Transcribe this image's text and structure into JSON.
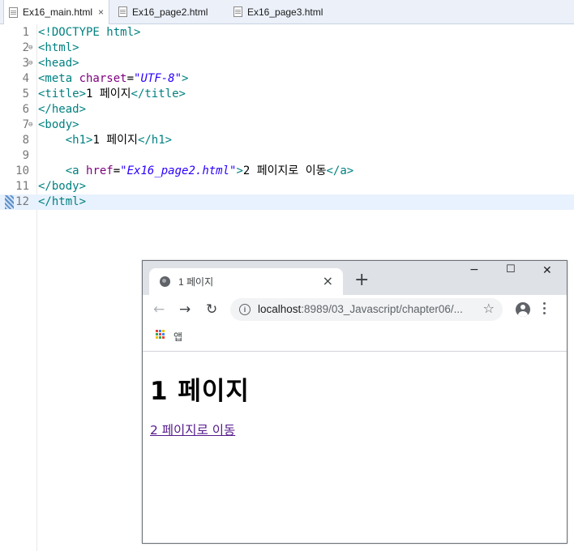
{
  "editor": {
    "tabs": [
      {
        "label": "Ex16_main.html",
        "active": true,
        "close": "×"
      },
      {
        "label": "Ex16_page2.html",
        "active": false
      },
      {
        "label": "Ex16_page3.html",
        "active": false
      }
    ],
    "lines": [
      {
        "n": "1",
        "parts": [
          [
            "tag",
            "<!DOCTYPE html>"
          ]
        ]
      },
      {
        "n": "2",
        "fold": "⊖",
        "parts": [
          [
            "tag",
            "<html>"
          ]
        ]
      },
      {
        "n": "3",
        "fold": "⊖",
        "parts": [
          [
            "tag",
            "<head>"
          ]
        ]
      },
      {
        "n": "4",
        "parts": [
          [
            "tag",
            "<meta "
          ],
          [
            "attr",
            "charset"
          ],
          [
            "txt",
            "="
          ],
          [
            "val",
            "\"UTF-8\""
          ],
          [
            "tag",
            ">"
          ]
        ]
      },
      {
        "n": "5",
        "parts": [
          [
            "tag",
            "<title>"
          ],
          [
            "txt",
            "1 페이지"
          ],
          [
            "tag",
            "</title>"
          ]
        ]
      },
      {
        "n": "6",
        "parts": [
          [
            "tag",
            "</head>"
          ]
        ]
      },
      {
        "n": "7",
        "fold": "⊖",
        "parts": [
          [
            "tag",
            "<body>"
          ]
        ]
      },
      {
        "n": "8",
        "parts": [
          [
            "txt",
            "    "
          ],
          [
            "tag",
            "<h1>"
          ],
          [
            "txt",
            "1 페이지"
          ],
          [
            "tag",
            "</h1>"
          ]
        ]
      },
      {
        "n": "9",
        "parts": []
      },
      {
        "n": "10",
        "parts": [
          [
            "txt",
            "    "
          ],
          [
            "tag",
            "<a "
          ],
          [
            "attr",
            "href"
          ],
          [
            "txt",
            "="
          ],
          [
            "val",
            "\"Ex16_page2.html\""
          ],
          [
            "tag",
            ">"
          ],
          [
            "txt",
            "2 페이지로 이동"
          ],
          [
            "tag",
            "</a>"
          ]
        ]
      },
      {
        "n": "11",
        "parts": [
          [
            "tag",
            "</body>"
          ]
        ]
      },
      {
        "n": "12",
        "current": true,
        "parts": [
          [
            "tag",
            "</html>"
          ]
        ]
      }
    ]
  },
  "browser": {
    "tab_title": "1 페이지",
    "tab_close": "×",
    "new_tab": "+",
    "window_controls": {
      "minimize": "−",
      "maximize": "☐",
      "close": "✕"
    },
    "nav": {
      "back": "←",
      "forward": "→",
      "reload": "↻"
    },
    "url_host": "localhost",
    "url_rest": ":8989/03_Javascript/chapter06/...",
    "star": "☆",
    "info": "i",
    "bookmarks": {
      "apps_label": "앱"
    },
    "page": {
      "heading": "1 페이지",
      "link": "2 페이지로 이동"
    }
  },
  "colors": {
    "tag": "#008080",
    "attr": "#7f007f",
    "value": "#2a00ff",
    "visited_link": "#551a8b",
    "chrome_frame": "#dee1e6"
  }
}
